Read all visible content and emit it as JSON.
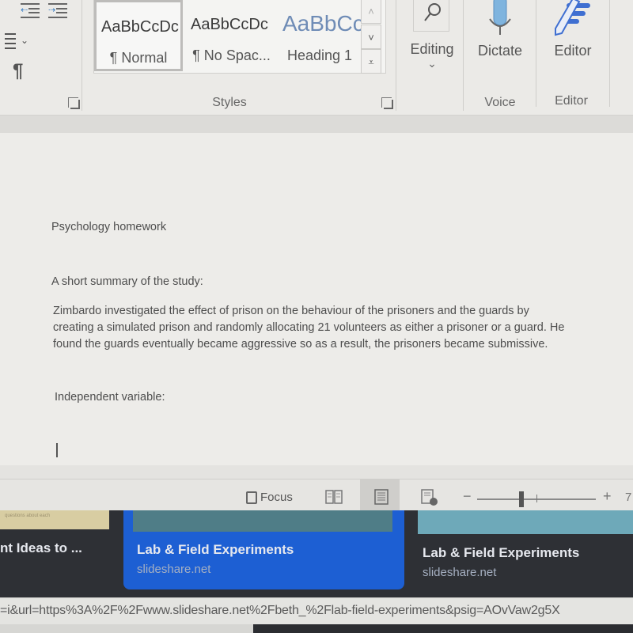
{
  "ribbon": {
    "paragraph_group": {
      "decrease_indent_icon": "decrease-indent-icon",
      "increase_indent_icon": "increase-indent-icon",
      "line_spacing_icon": "line-spacing-icon",
      "show_marks_icon": "pilcrow-icon",
      "pilcrow": "¶",
      "dropdown_chevron": "⌄"
    },
    "styles": {
      "group_label": "Styles",
      "items": [
        {
          "sample": "AaBbCcDc",
          "name": "¶ Normal",
          "selected": true
        },
        {
          "sample": "AaBbCcDc",
          "name": "¶ No Spac...",
          "selected": false
        },
        {
          "sample": "AaBbCc",
          "name": "Heading 1",
          "selected": false
        }
      ],
      "scroll_up": "˄",
      "scroll_down": "˅",
      "more": "⩡"
    },
    "editing": {
      "label": "Editing",
      "chevron": "⌄",
      "icon": "search-icon"
    },
    "voice": {
      "button_label": "Dictate",
      "group_label": "Voice",
      "icon": "microphone-icon"
    },
    "editor": {
      "button_label": "Editor",
      "group_label": "Editor",
      "icon": "editor-pen-icon"
    }
  },
  "document": {
    "title_line": "Psychology homework",
    "summary_heading": "A short summary of the study:",
    "summary_lines": [
      "Zimbardo investigated the effect of prison on the behaviour of the prisoners and the guards by",
      "creating a simulated prison and randomly allocating 21 volunteers as either a prisoner or a guard. He",
      "found the guards eventually became aggressive so as a result, the prisoners became submissive."
    ],
    "independent_variable_label": "Independent variable:"
  },
  "statusbar": {
    "focus_label": "Focus",
    "views": [
      "read-mode",
      "print-layout",
      "web-layout"
    ],
    "active_view": "print-layout",
    "zoom_minus": "−",
    "zoom_plus": "+",
    "zoom_pct_partial": "7"
  },
  "browser": {
    "cards": [
      {
        "thumb_text": "questions about each",
        "title": "nt Ideas to ...",
        "site": ""
      },
      {
        "title": "Lab & Field Experiments",
        "site": "slideshare.net",
        "highlighted": true
      },
      {
        "title": "Lab & Field Experiments",
        "site": "slideshare.net",
        "highlighted": false
      }
    ],
    "url_text": "=i&url=https%3A%2F%2Fwww.slideshare.net%2Fbeth_%2Flab-field-experiments&psig=AOvVaw2g5X"
  },
  "colors": {
    "highlight_card": "#1d5fd3",
    "heading_style": "#6f8cb6",
    "microphone": "#7fb4de",
    "editor_pen": "#3f6fd1"
  }
}
